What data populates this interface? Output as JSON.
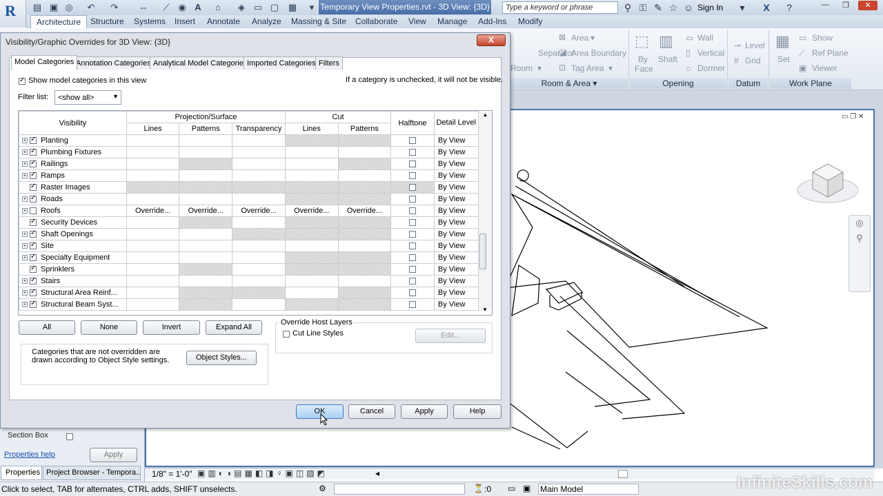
{
  "app": {
    "doc_title": "Temporary View Properties.rvt - 3D View: {3D}",
    "search_placeholder": "Type a keyword or phrase",
    "sign_in": "Sign In"
  },
  "ribbon": {
    "tabs": [
      "Architecture",
      "Structure",
      "Systems",
      "Insert",
      "Annotate",
      "Analyze",
      "Massing & Site",
      "Collaborate",
      "View",
      "Manage",
      "Add-Ins",
      "Modify"
    ],
    "room_area": {
      "area": "Area",
      "separator": "Separator",
      "area_boundary": "Area Boundary",
      "room": "Room",
      "tag_area": "Tag Area",
      "label": "Room & Area"
    },
    "opening": {
      "wall": "Wall",
      "vertical": "Vertical",
      "by_face": "By Face",
      "shaft": "Shaft",
      "dormer": "Dormer",
      "label": "Opening"
    },
    "datum": {
      "level": "Level",
      "grid": "Grid",
      "label": "Datum"
    },
    "work_plane": {
      "set": "Set",
      "show": "Show",
      "ref_plane": "Ref Plane",
      "viewer": "Viewer",
      "label": "Work Plane"
    }
  },
  "dialog": {
    "title": "Visibility/Graphic Overrides for 3D View: {3D}",
    "close": "X",
    "tabs": [
      "Model Categories",
      "Annotation Categories",
      "Analytical Model Categories",
      "Imported Categories",
      "Filters"
    ],
    "show_model_categories": "Show model categories in this view",
    "hint": "If a category is unchecked, it will not be visible.",
    "filter_label": "Filter list:",
    "filter_value": "<show all>",
    "columns": {
      "visibility": "Visibility",
      "projection_surface": "Projection/Surface",
      "cut": "Cut",
      "lines": "Lines",
      "patterns": "Patterns",
      "transparency": "Transparency",
      "halftone": "Halftone",
      "detail_level": "Detail Level"
    },
    "rows": [
      {
        "name": "Planting",
        "checked": true,
        "expand": true,
        "hatch": [
          0,
          0,
          0,
          1,
          1
        ],
        "detail": "By View"
      },
      {
        "name": "Plumbing Fixtures",
        "checked": true,
        "expand": true,
        "hatch": [
          0,
          0,
          0,
          0,
          0
        ],
        "detail": "By View"
      },
      {
        "name": "Railings",
        "checked": true,
        "expand": true,
        "hatch": [
          0,
          1,
          0,
          0,
          1
        ],
        "detail": "By View"
      },
      {
        "name": "Ramps",
        "checked": true,
        "expand": true,
        "hatch": [
          0,
          0,
          0,
          0,
          0
        ],
        "detail": "By View"
      },
      {
        "name": "Raster Images",
        "checked": true,
        "expand": false,
        "hatch": [
          1,
          1,
          1,
          1,
          1
        ],
        "detail": "By View"
      },
      {
        "name": "Roads",
        "checked": true,
        "expand": true,
        "hatch": [
          0,
          0,
          0,
          1,
          1
        ],
        "detail": "By View"
      },
      {
        "name": "Roofs",
        "checked": false,
        "expand": true,
        "override": true,
        "detail": "By View"
      },
      {
        "name": "Security Devices",
        "checked": true,
        "expand": false,
        "hatch": [
          0,
          1,
          0,
          1,
          1
        ],
        "detail": "By View"
      },
      {
        "name": "Shaft Openings",
        "checked": true,
        "expand": true,
        "hatch": [
          0,
          0,
          1,
          1,
          1
        ],
        "detail": "By View"
      },
      {
        "name": "Site",
        "checked": true,
        "expand": true,
        "hatch": [
          0,
          0,
          0,
          0,
          0
        ],
        "detail": "By View"
      },
      {
        "name": "Specialty Equipment",
        "checked": true,
        "expand": true,
        "hatch": [
          0,
          0,
          0,
          1,
          1
        ],
        "detail": "By View"
      },
      {
        "name": "Sprinklers",
        "checked": true,
        "expand": false,
        "hatch": [
          0,
          1,
          0,
          1,
          1
        ],
        "detail": "By View"
      },
      {
        "name": "Stairs",
        "checked": true,
        "expand": true,
        "hatch": [
          0,
          0,
          0,
          0,
          0
        ],
        "detail": "By View"
      },
      {
        "name": "Structural Area Reinf...",
        "checked": true,
        "expand": true,
        "hatch": [
          0,
          1,
          1,
          0,
          1
        ],
        "detail": "By View"
      },
      {
        "name": "Structural Beam Syst...",
        "checked": true,
        "expand": true,
        "hatch": [
          0,
          1,
          0,
          1,
          1
        ],
        "detail": "By View"
      }
    ],
    "override_label": "Override...",
    "buttons": {
      "all": "All",
      "none": "None",
      "invert": "Invert",
      "expand_all": "Expand All"
    },
    "host_layers": {
      "legend": "Override Host Layers",
      "cut_line_styles": "Cut Line Styles",
      "edit": "Edit..."
    },
    "note": "Categories that are not overridden are drawn according to Object Style settings.",
    "object_styles": "Object Styles...",
    "ok": "OK",
    "cancel": "Cancel",
    "apply": "Apply",
    "help": "Help"
  },
  "properties": {
    "section_box": "Section Box",
    "help_link": "Properties help",
    "apply": "Apply",
    "tab_properties": "Properties",
    "tab_browser": "Project Browser - Tempora..."
  },
  "view_control": {
    "scale": "1/8\" = 1'-0\""
  },
  "status": {
    "hint": "Click to select, TAB for alternates, CTRL adds, SHIFT unselects.",
    "count": ":0",
    "model": "Main Model",
    "watermark": "InfiniteSkills.com"
  }
}
